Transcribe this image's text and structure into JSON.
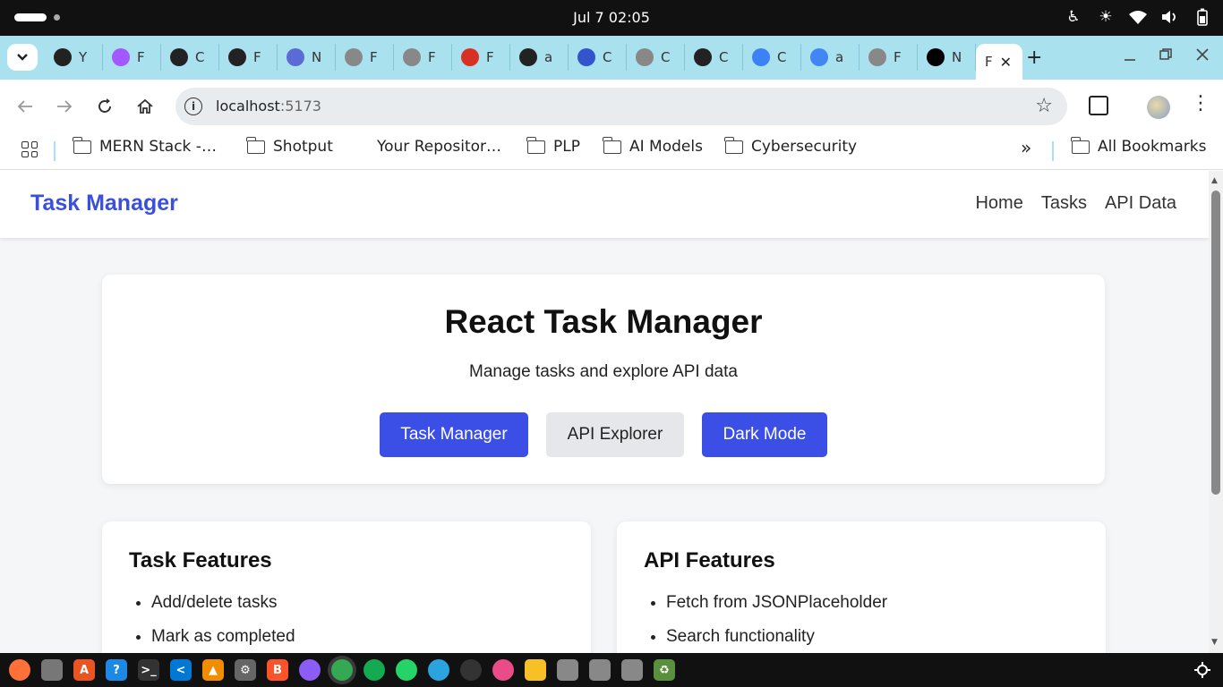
{
  "system": {
    "clock": "Jul 7  02:05",
    "tray_icons": [
      "accessibility-icon",
      "brightness-icon",
      "wifi-icon",
      "volume-icon",
      "battery-icon"
    ]
  },
  "browser": {
    "tabs": [
      {
        "letter": "Y",
        "icon": "github-icon",
        "color": "#222222"
      },
      {
        "letter": "F",
        "icon": "figma-icon",
        "color": "#a259ff"
      },
      {
        "letter": "C",
        "icon": "github-icon",
        "color": "#222222"
      },
      {
        "letter": "F",
        "icon": "github-icon",
        "color": "#222222"
      },
      {
        "letter": "N",
        "icon": "app-icon",
        "color": "#5b6bd6"
      },
      {
        "letter": "F",
        "icon": "globe-icon",
        "color": "#888888"
      },
      {
        "letter": "F",
        "icon": "globe-icon",
        "color": "#888888"
      },
      {
        "letter": "F",
        "icon": "gmail-icon",
        "color": "#d93025"
      },
      {
        "letter": "a",
        "icon": "github-icon",
        "color": "#222222"
      },
      {
        "letter": "C",
        "icon": "person-icon",
        "color": "#3355cc"
      },
      {
        "letter": "C",
        "icon": "globe-icon",
        "color": "#888888"
      },
      {
        "letter": "C",
        "icon": "openai-icon",
        "color": "#222222"
      },
      {
        "letter": "C",
        "icon": "gemini-icon",
        "color": "#3b82f6"
      },
      {
        "letter": "a",
        "icon": "google-icon",
        "color": "#4285f4"
      },
      {
        "letter": "F",
        "icon": "globe-icon",
        "color": "#888888"
      },
      {
        "letter": "N",
        "icon": "vite-icon",
        "color": "#000000"
      }
    ],
    "active_tab_letter": "F",
    "url_host": "localhost",
    "url_port": ":5173",
    "bookmarks": [
      {
        "label": "MERN Stack -…",
        "folder": true
      },
      {
        "label": "Shotput",
        "folder": true
      },
      {
        "label": "Your Repositor…",
        "folder": false
      },
      {
        "label": "PLP",
        "folder": true
      },
      {
        "label": "AI Models",
        "folder": true
      },
      {
        "label": "Cybersecurity",
        "folder": true
      }
    ],
    "overflow_label": "»",
    "all_bookmarks_label": "All Bookmarks"
  },
  "app": {
    "brand": "Task Manager",
    "nav": [
      "Home",
      "Tasks",
      "API Data"
    ],
    "hero": {
      "title": "React Task Manager",
      "subtitle": "Manage tasks and explore API data",
      "buttons": [
        "Task Manager",
        "API Explorer",
        "Dark Mode"
      ]
    },
    "cards": [
      {
        "title": "Task Features",
        "items": [
          "Add/delete tasks",
          "Mark as completed"
        ]
      },
      {
        "title": "API Features",
        "items": [
          "Fetch from JSONPlaceholder",
          "Search functionality"
        ]
      }
    ]
  },
  "dock": {
    "apps": [
      {
        "name": "firefox-icon",
        "glyph": "",
        "color": "#ff7139"
      },
      {
        "name": "files-icon",
        "glyph": "",
        "color": "#777777"
      },
      {
        "name": "app-center-icon",
        "glyph": "A",
        "color": "#e95420"
      },
      {
        "name": "help-icon",
        "glyph": "?",
        "color": "#1e88e5"
      },
      {
        "name": "terminal-icon",
        "glyph": ">_",
        "color": "#333333"
      },
      {
        "name": "vscode-icon",
        "glyph": "<",
        "color": "#0078d4"
      },
      {
        "name": "vlc-icon",
        "glyph": "▲",
        "color": "#f28c00"
      },
      {
        "name": "settings-icon",
        "glyph": "⚙",
        "color": "#666666"
      },
      {
        "name": "brave-icon",
        "glyph": "B",
        "color": "#fb542b"
      },
      {
        "name": "app-icon",
        "glyph": "",
        "color": "#8b5cf6"
      },
      {
        "name": "chrome-icon",
        "glyph": "",
        "color": "#34a853"
      },
      {
        "name": "mongodb-icon",
        "glyph": "",
        "color": "#13aa52"
      },
      {
        "name": "whatsapp-icon",
        "glyph": "",
        "color": "#25d366"
      },
      {
        "name": "telegram-icon",
        "glyph": "",
        "color": "#2aa3df"
      },
      {
        "name": "github-icon",
        "glyph": "",
        "color": "#333333"
      },
      {
        "name": "app-icon",
        "glyph": "",
        "color": "#ea4c89"
      },
      {
        "name": "notes-icon",
        "glyph": "",
        "color": "#f6c026"
      },
      {
        "name": "document-icon",
        "glyph": "",
        "color": "#888888"
      },
      {
        "name": "disk-icon",
        "glyph": "",
        "color": "#888888"
      },
      {
        "name": "disk-icon",
        "glyph": "",
        "color": "#888888"
      },
      {
        "name": "trash-icon",
        "glyph": "♻",
        "color": "#5a8f3d"
      }
    ]
  }
}
